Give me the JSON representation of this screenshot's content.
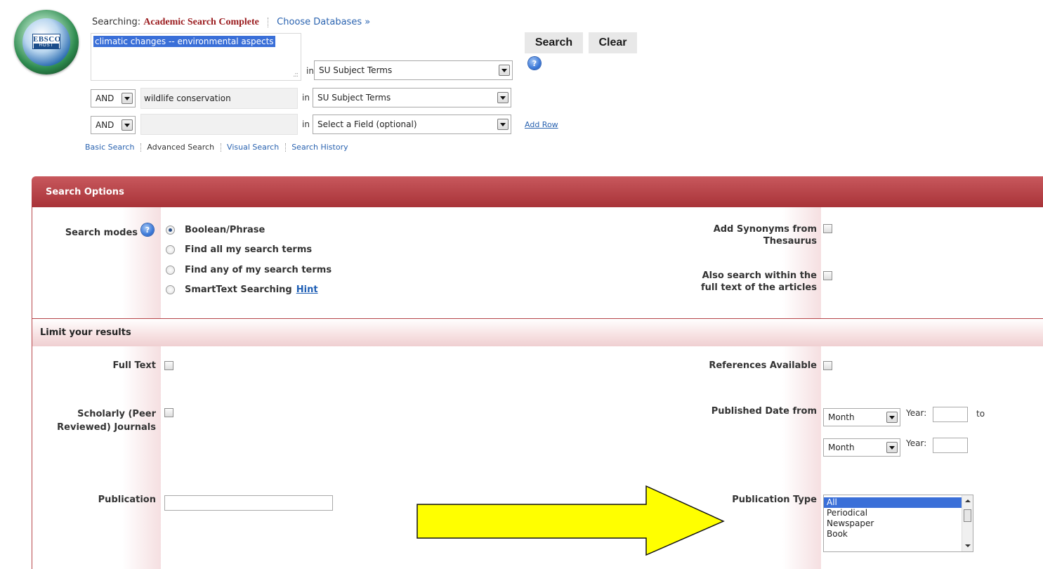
{
  "header": {
    "searching_label": "Searching:",
    "database": "Academic Search Complete",
    "choose_databases": "Choose Databases »",
    "logo_text_top": "EBSCO",
    "logo_text_bottom": "HOST"
  },
  "search": {
    "rows": [
      {
        "operator": "",
        "query": "climatic changes -- environmental aspects",
        "in_label": "in",
        "field": "SU Subject Terms"
      },
      {
        "operator": "AND",
        "query": "wildlife conservation",
        "in_label": "in",
        "field": "SU Subject Terms"
      },
      {
        "operator": "AND",
        "query": "",
        "in_label": "in",
        "field": "Select a Field (optional)"
      }
    ],
    "search_button": "Search",
    "clear_button": "Clear",
    "help_icon": "?",
    "add_row": "Add Row"
  },
  "nav": {
    "basic": "Basic Search",
    "advanced": "Advanced Search",
    "visual": "Visual Search",
    "history": "Search History"
  },
  "search_options": {
    "title": "Search Options",
    "search_modes_label": "Search modes",
    "modes": [
      {
        "label": "Boolean/Phrase",
        "selected": true
      },
      {
        "label": "Find all my search terms",
        "selected": false
      },
      {
        "label": "Find any of my search terms",
        "selected": false
      },
      {
        "label": "SmartText Searching",
        "selected": false
      }
    ],
    "hint": "Hint",
    "add_synonyms_label": "Add Synonyms from Thesaurus",
    "add_synonyms_line1": "Add Synonyms from",
    "add_synonyms_line2": "Thesaurus",
    "fulltext_search_line1": "Also search within the",
    "fulltext_search_line2": "full text of the articles"
  },
  "limits": {
    "title": "Limit your results",
    "full_text": "Full Text",
    "scholarly_line1": "Scholarly (Peer",
    "scholarly_line2": "Reviewed) Journals",
    "publication": "Publication",
    "publication_value": "",
    "references_available": "References Available",
    "published_date_from": "Published Date from",
    "month_placeholder": "Month",
    "year_label": "Year:",
    "to_label": "to",
    "publication_type": "Publication Type",
    "publication_types": [
      "All",
      "Periodical",
      "Newspaper",
      "Book"
    ],
    "selected_publication_type": "All"
  },
  "colors": {
    "panel_header": "#b1393e",
    "selection": "#3a6fd8",
    "link": "#2a63b0",
    "arrow_fill": "#ffff00"
  }
}
